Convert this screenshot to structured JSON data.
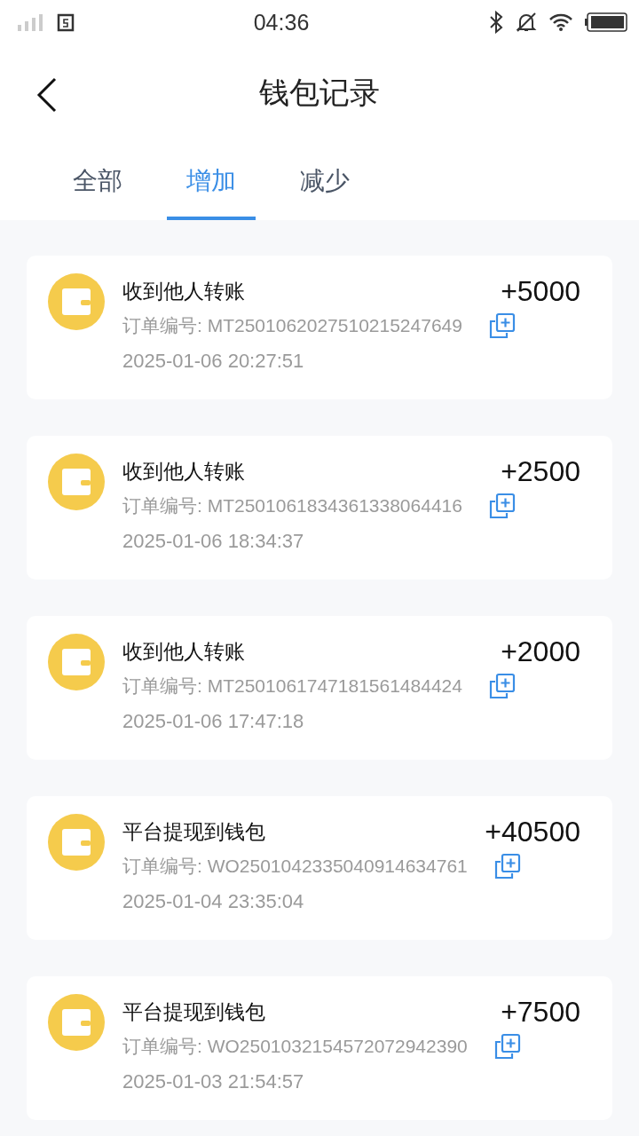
{
  "status_bar": {
    "time": "04:36"
  },
  "header": {
    "title": "钱包记录"
  },
  "tabs": [
    {
      "label": "全部",
      "selected": false
    },
    {
      "label": "增加",
      "selected": true
    },
    {
      "label": "减少",
      "selected": false
    }
  ],
  "records": [
    {
      "title": "收到他人转账",
      "amount": "+5000",
      "order": "订单编号: MT2501062027510215247649",
      "time": "2025-01-06 20:27:51"
    },
    {
      "title": "收到他人转账",
      "amount": "+2500",
      "order": "订单编号: MT2501061834361338064416",
      "time": "2025-01-06 18:34:37"
    },
    {
      "title": "收到他人转账",
      "amount": "+2000",
      "order": "订单编号: MT2501061747181561484424",
      "time": "2025-01-06 17:47:18"
    },
    {
      "title": "平台提现到钱包",
      "amount": "+40500",
      "order": "订单编号: WO2501042335040914634761",
      "time": "2025-01-04 23:35:04"
    },
    {
      "title": "平台提现到钱包",
      "amount": "+7500",
      "order": "订单编号: WO2501032154572072942390",
      "time": "2025-01-03 21:54:57"
    }
  ]
}
